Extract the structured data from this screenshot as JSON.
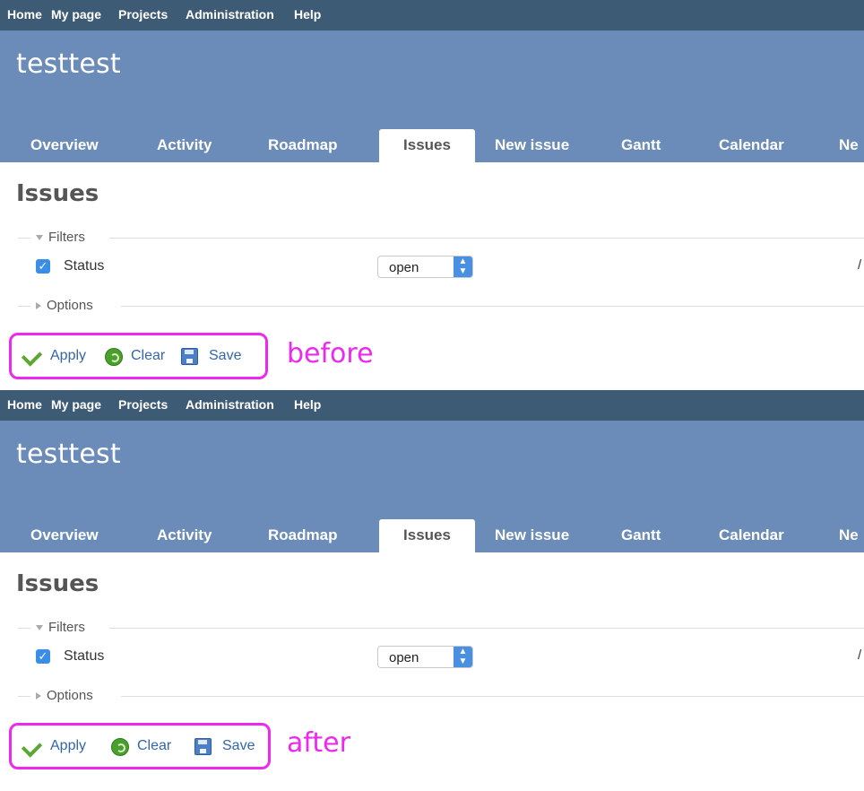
{
  "top_menu": [
    "Home",
    "My page",
    "Projects",
    "Administration",
    "Help"
  ],
  "project_title": "testtest",
  "tabs": [
    "Overview",
    "Activity",
    "Roadmap",
    "Issues",
    "New issue",
    "Gantt",
    "Calendar",
    "Ne"
  ],
  "selected_tab": "Issues",
  "page_title": "Issues",
  "filters_label": "Filters",
  "status_label": "Status",
  "status_select_value": "open",
  "options_label": "Options",
  "truncated_right_text": "/",
  "actions": {
    "apply": "Apply",
    "clear": "Clear",
    "save": "Save"
  },
  "annotations": {
    "before": "before",
    "after": "after"
  },
  "colors": {
    "top_menu": "#3e5b76",
    "header": "#6b8cb8",
    "highlight": "#ee28ee",
    "link": "#3366aa"
  },
  "icons": [
    "checkbox-checked-icon",
    "select-arrow-icon",
    "checkmark-icon",
    "reload-icon",
    "floppy-disk-icon"
  ]
}
